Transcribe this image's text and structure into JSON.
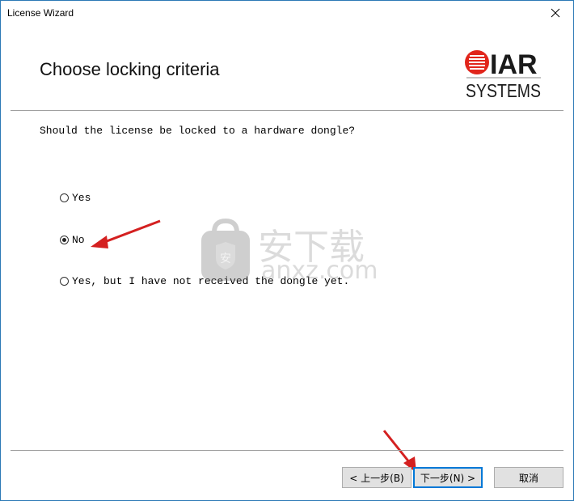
{
  "window": {
    "title": "License Wizard",
    "close_icon": "close-icon"
  },
  "header": {
    "page_title": "Choose locking criteria",
    "logo": {
      "brand_top": "IAR",
      "brand_bottom": "SYSTEMS",
      "accent_color": "#e1251b"
    }
  },
  "body": {
    "question": "Should the license be locked to a hardware dongle?",
    "options": [
      {
        "label": "Yes",
        "checked": false
      },
      {
        "label": "No",
        "checked": true
      },
      {
        "label": "Yes, but I have not received the dongle yet.",
        "checked": false
      }
    ]
  },
  "watermark": {
    "cn_text": "安下载",
    "domain": "anxz.com",
    "badge_char": "安"
  },
  "footer": {
    "back_label": "< 上一步(B)",
    "next_label": "下一步(N) >",
    "cancel_label": "取消"
  },
  "colors": {
    "annotation_arrow": "#d42020",
    "default_button_border": "#0078d7",
    "window_border": "#2b79b5"
  }
}
